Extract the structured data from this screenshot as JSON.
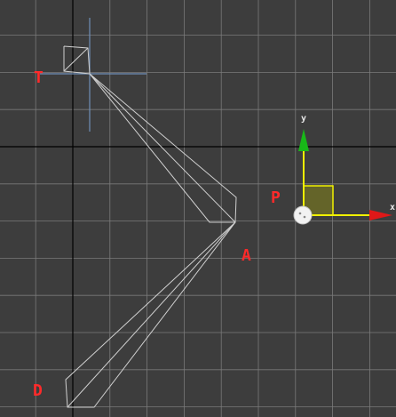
{
  "viewport": {
    "background": "#3d3d3d",
    "grid_color": "#7a7a7a",
    "home_grid_color": "#000000",
    "bone_color": "#d0d0d0",
    "crosshair_color": "#6f8fb8",
    "label_color": "#ff2a2a"
  },
  "labels": {
    "target": "T",
    "pivot": "P",
    "a": "A",
    "d": "D"
  },
  "gizmo": {
    "x_axis_label": "x",
    "y_axis_label": "y",
    "x_color": "#e01818",
    "y_color": "#18b818",
    "axis_line_color": "#f0f000",
    "plane_color": "#6b6b26"
  }
}
